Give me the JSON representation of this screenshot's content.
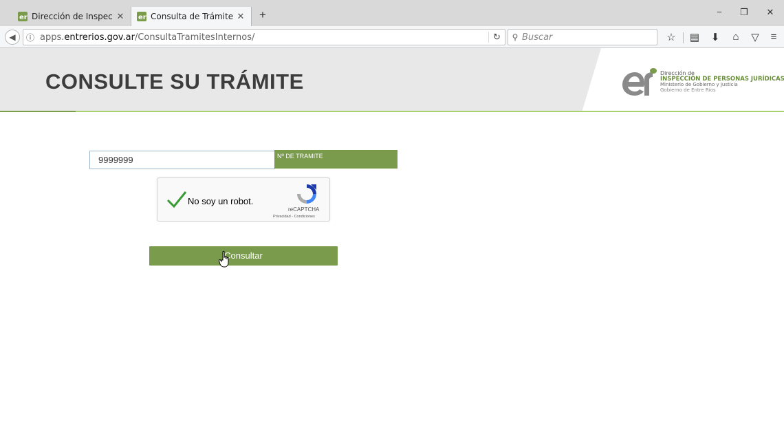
{
  "browser": {
    "tabs": [
      {
        "title": "Dirección de Inspección de P",
        "active": false
      },
      {
        "title": "Consulta de Trámites Interno",
        "active": true
      }
    ],
    "new_tab": "+",
    "url_prefix": "apps.",
    "url_domain": "entrerios.gov.ar",
    "url_path": "/ConsultaTramitesInternos/",
    "search_placeholder": "Buscar",
    "window_controls": {
      "minimize": "−",
      "restore": "❐",
      "close": "✕"
    },
    "toolbar_icons": [
      "bookmark-star-icon",
      "reading-list-icon",
      "download-icon",
      "home-icon",
      "pocket-icon",
      "menu-icon"
    ]
  },
  "header": {
    "title": "CONSULTE SU TRÁMITE",
    "logo": {
      "line1": "Dirección de",
      "line2": "INSPECCIÓN DE PERSONAS JURÍDICAS",
      "line3": "Ministerio de Gobierno y Justicia",
      "line4": "Gobierno de Entre Ríos"
    }
  },
  "form": {
    "tramite_value": "9999999",
    "tramite_label": "Nº DE TRAMITE",
    "captcha": {
      "label": "No soy un robot.",
      "brand": "reCAPTCHA",
      "links": "Privacidad - Condiciones",
      "checked": true
    },
    "submit_label": "Consultar"
  },
  "colors": {
    "accent_green": "#799b4b",
    "header_bg": "#e8e8e9",
    "rule_green": "#a9d06f",
    "title_text": "#3c3c3c"
  }
}
